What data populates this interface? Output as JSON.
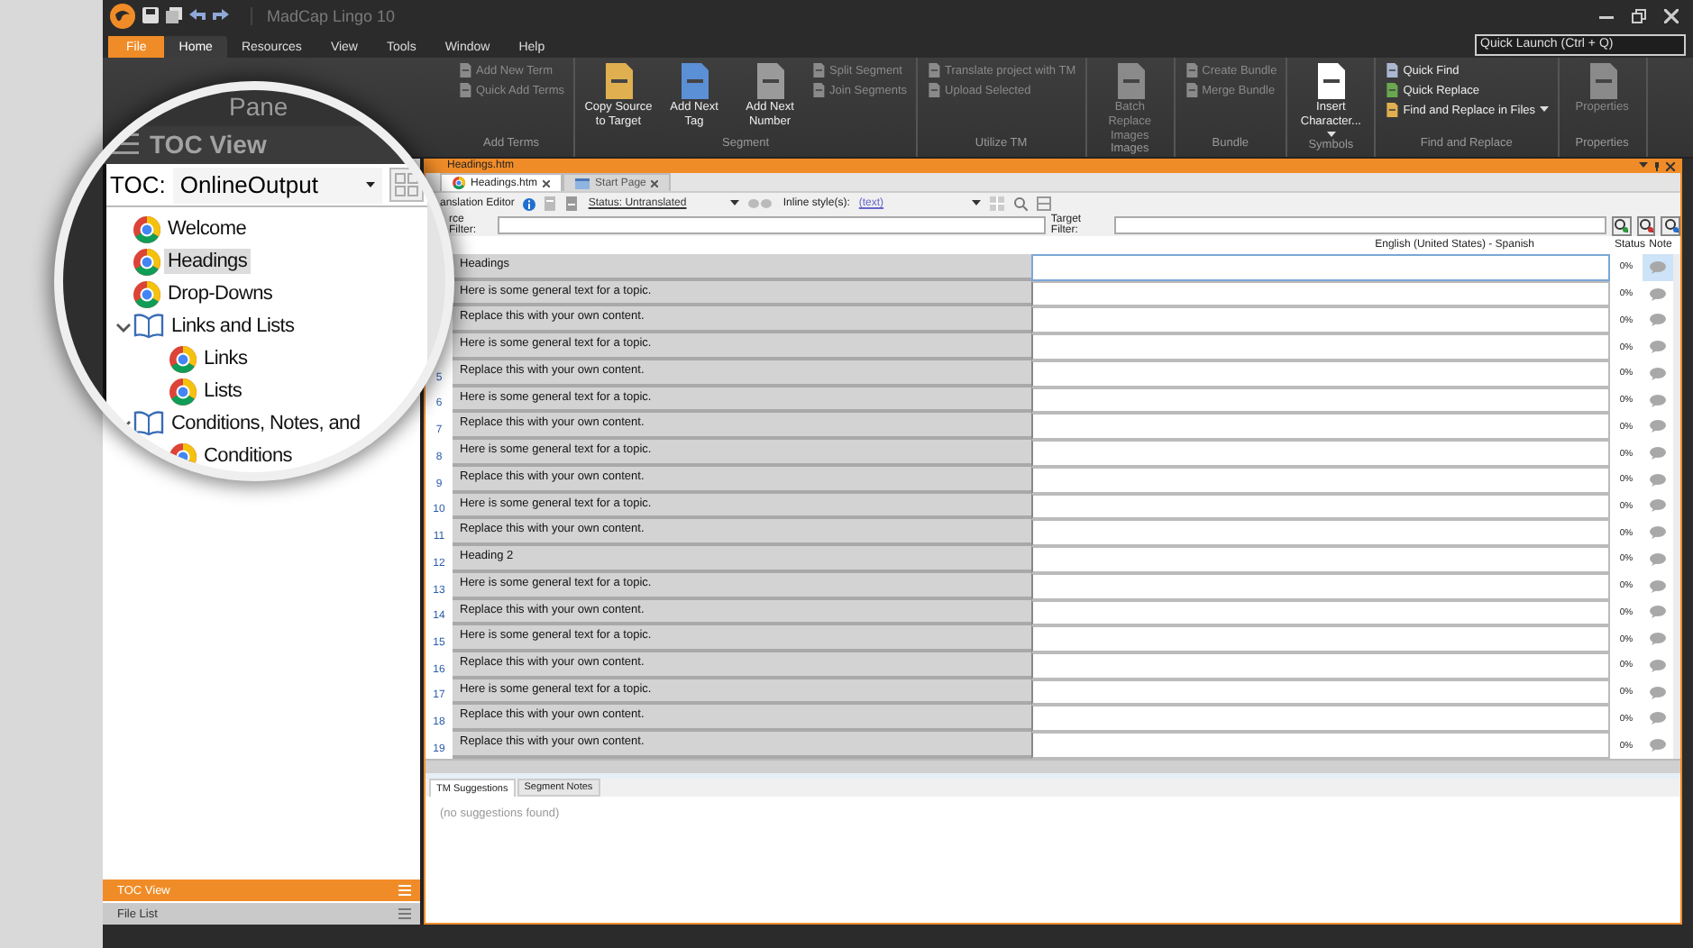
{
  "title_bar": {
    "app_title": "MadCap Lingo 10",
    "quick_launch": {
      "placeholder": "Quick Launch (Ctrl + Q)"
    }
  },
  "menu_tabs": [
    {
      "label": "File",
      "kind": "file",
      "selected": false
    },
    {
      "label": "Home",
      "kind": "tab",
      "selected": true
    },
    {
      "label": "Resources",
      "kind": "tab",
      "selected": false
    },
    {
      "label": "View",
      "kind": "tab",
      "selected": false
    },
    {
      "label": "Tools",
      "kind": "tab",
      "selected": false
    },
    {
      "label": "Window",
      "kind": "tab",
      "selected": false
    },
    {
      "label": "Help",
      "kind": "tab",
      "selected": false
    }
  ],
  "ribbon": {
    "groups": [
      {
        "label": "Add Terms",
        "items": [
          {
            "label": "Add New Term",
            "kind": "small",
            "disabled": true
          },
          {
            "label": "Quick Add Terms",
            "kind": "small",
            "disabled": true
          }
        ]
      },
      {
        "label": "Segment",
        "items": [
          {
            "label": "Copy Source to Target",
            "kind": "large",
            "disabled": false
          },
          {
            "label": "Add Next Tag",
            "kind": "large",
            "disabled": false
          },
          {
            "label": "Add Next Number",
            "kind": "large",
            "disabled": false
          },
          {
            "label": "Split Segment",
            "kind": "small",
            "disabled": true
          },
          {
            "label": "Join Segments",
            "kind": "small",
            "disabled": true
          }
        ]
      },
      {
        "label": "Utilize TM",
        "items": [
          {
            "label": "Translate project with TM",
            "kind": "small",
            "disabled": true
          },
          {
            "label": "Upload Selected",
            "kind": "small",
            "disabled": true
          }
        ]
      },
      {
        "label": "Images",
        "items": [
          {
            "label": "Batch Replace Images",
            "kind": "large",
            "disabled": true
          }
        ]
      },
      {
        "label": "Bundle",
        "items": [
          {
            "label": "Create Bundle",
            "kind": "small",
            "disabled": true
          },
          {
            "label": "Merge Bundle",
            "kind": "small",
            "disabled": true
          }
        ]
      },
      {
        "label": "Symbols",
        "items": [
          {
            "label": "Insert Character...",
            "kind": "large",
            "disabled": false,
            "dropdown": true
          }
        ]
      },
      {
        "label": "Find and Replace",
        "items": [
          {
            "label": "Quick Find",
            "kind": "small",
            "disabled": false
          },
          {
            "label": "Quick Replace",
            "kind": "small",
            "disabled": false
          },
          {
            "label": "Find and Replace in Files",
            "kind": "small",
            "disabled": false,
            "dropdown": true
          }
        ]
      },
      {
        "label": "Properties",
        "items": [
          {
            "label": "Properties",
            "kind": "large",
            "disabled": true
          }
        ]
      }
    ]
  },
  "magnifier": {
    "ribbon_label": "Pane",
    "panel_title": "TOC View",
    "toc_label": "TOC:",
    "toc_value": "OnlineOutput",
    "tree": [
      {
        "label": "Welcome",
        "kind": "page",
        "selected": false
      },
      {
        "label": "Headings",
        "kind": "page",
        "selected": true
      },
      {
        "label": "Drop-Downs",
        "kind": "page",
        "selected": false
      },
      {
        "label": "Links and Lists",
        "kind": "book",
        "selected": false,
        "expanded": true,
        "children": [
          {
            "label": "Links",
            "kind": "page",
            "selected": false
          },
          {
            "label": "Lists",
            "kind": "page",
            "selected": false
          }
        ]
      },
      {
        "label": "Conditions, Notes, and",
        "kind": "book",
        "selected": false,
        "expanded": true,
        "children": [
          {
            "label": "Conditions",
            "kind": "page",
            "selected": false
          }
        ]
      }
    ]
  },
  "left_panel": {
    "tabs": [
      {
        "label": "TOC View",
        "selected": true
      },
      {
        "label": "File List",
        "selected": false
      }
    ]
  },
  "editor": {
    "title": "Headings.htm",
    "doc_tabs": [
      {
        "label": "Headings.htm",
        "kind": "page",
        "selected": true
      },
      {
        "label": "Start Page",
        "kind": "start",
        "selected": false
      }
    ],
    "toolbar": {
      "label": "anslation Editor",
      "status": "Status: Untranslated",
      "inline_label": "Inline style(s):",
      "inline_value": "(text)"
    },
    "source_filter_label": "rce Filter:",
    "target_filter_label": "Target Filter:",
    "language_header": "English (United States) - Spanish",
    "status_header": "Status",
    "note_header": "Note",
    "rows": [
      {
        "source": "Headings",
        "status": "0%",
        "selected": true
      },
      {
        "source": "Here is some general text for a topic.",
        "status": "0%",
        "selected": false
      },
      {
        "source": "Replace this with your own content.",
        "status": "0%",
        "selected": false
      },
      {
        "source": "Here is some general text for a topic.",
        "status": "0%",
        "selected": false
      },
      {
        "number": "5",
        "source": "Replace this with your own content.",
        "status": "0%",
        "selected": false
      },
      {
        "number": "6",
        "source": "Here is some general text for a topic.",
        "status": "0%",
        "selected": false
      },
      {
        "number": "7",
        "source": "Replace this with your own content.",
        "status": "0%",
        "selected": false
      },
      {
        "number": "8",
        "source": "Here is some general text for a topic.",
        "status": "0%",
        "selected": false
      },
      {
        "number": "9",
        "source": "Replace this with your own content.",
        "status": "0%",
        "selected": false
      },
      {
        "number": "10",
        "source": "Here is some general text for a topic.",
        "status": "0%",
        "selected": false
      },
      {
        "number": "11",
        "source": "Replace this with your own content.",
        "status": "0%",
        "selected": false
      },
      {
        "number": "12",
        "source": "Heading 2",
        "status": "0%",
        "selected": false
      },
      {
        "number": "13",
        "source": "Here is some general text for a topic.",
        "status": "0%",
        "selected": false
      },
      {
        "number": "14",
        "source": "Replace this with your own content.",
        "status": "0%",
        "selected": false
      },
      {
        "number": "15",
        "source": "Here is some general text for a topic.",
        "status": "0%",
        "selected": false
      },
      {
        "number": "16",
        "source": "Replace this with your own content.",
        "status": "0%",
        "selected": false
      },
      {
        "number": "17",
        "source": "Here is some general text for a topic.",
        "status": "0%",
        "selected": false
      },
      {
        "number": "18",
        "source": "Replace this with your own content.",
        "status": "0%",
        "selected": false
      },
      {
        "number": "19",
        "source": "Replace this with your own content.",
        "status": "0%",
        "selected": false
      }
    ]
  },
  "bottom_pane": {
    "tabs": [
      {
        "label": "TM Suggestions",
        "selected": true
      },
      {
        "label": "Segment Notes",
        "selected": false
      }
    ],
    "message": "(no suggestions found)"
  }
}
